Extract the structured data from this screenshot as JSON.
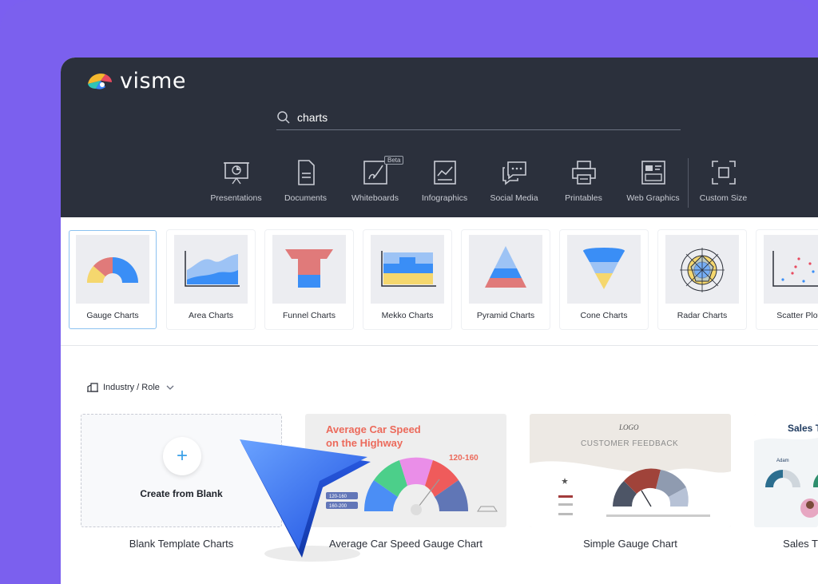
{
  "app": {
    "name": "visme"
  },
  "search": {
    "value": "charts",
    "icon": "search-icon"
  },
  "categories": [
    {
      "label": "Presentations",
      "icon": "presentation-icon"
    },
    {
      "label": "Documents",
      "icon": "document-icon"
    },
    {
      "label": "Whiteboards",
      "icon": "whiteboard-icon",
      "badge": "Beta"
    },
    {
      "label": "Infographics",
      "icon": "infographic-icon"
    },
    {
      "label": "Social Media",
      "icon": "social-media-icon"
    },
    {
      "label": "Printables",
      "icon": "printer-icon"
    },
    {
      "label": "Web Graphics",
      "icon": "web-graphics-icon"
    },
    {
      "label": "Custom Size",
      "icon": "custom-size-icon"
    }
  ],
  "chart_types": [
    {
      "label": "Gauge Charts",
      "selected": true
    },
    {
      "label": "Area Charts"
    },
    {
      "label": "Funnel Charts"
    },
    {
      "label": "Mekko Charts"
    },
    {
      "label": "Pyramid Charts"
    },
    {
      "label": "Cone Charts"
    },
    {
      "label": "Radar Charts"
    },
    {
      "label": "Scatter Plots"
    }
  ],
  "filter": {
    "label": "Industry / Role"
  },
  "templates": {
    "blank": {
      "action": "Create from Blank",
      "label": "Blank Template Charts"
    },
    "car_speed": {
      "label": "Average Car Speed Gauge Chart",
      "title_line1": "Average Car Speed",
      "title_line2": "on the Highway",
      "range": "120-160",
      "tags": [
        "120-160",
        "160-200"
      ]
    },
    "feedback": {
      "label": "Simple Gauge Chart",
      "logo": "LOGO",
      "title": "CUSTOMER FEEDBACK"
    },
    "sales": {
      "label": "Sales T",
      "title": "Sales T",
      "person": "Adam"
    }
  },
  "colors": {
    "accent": "#3aa0e8",
    "background": "#7b60ee",
    "topbar": "#2b303c"
  }
}
